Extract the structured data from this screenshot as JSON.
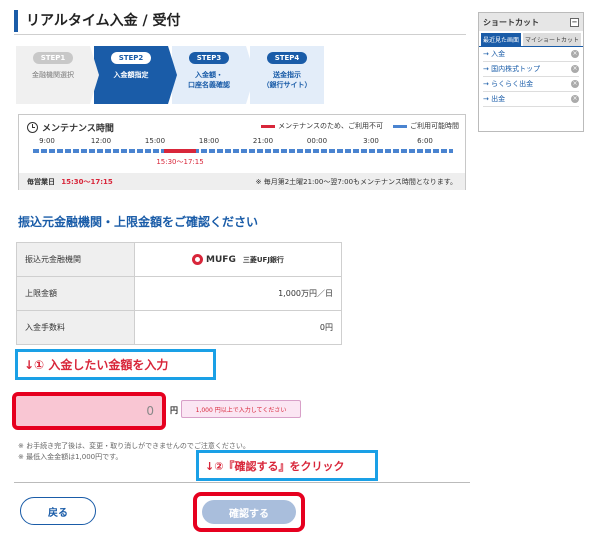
{
  "page": {
    "title": "リアルタイム入金 / 受付"
  },
  "steps": [
    {
      "badge": "STEP1",
      "label": "金融機関選択",
      "state": "done"
    },
    {
      "badge": "STEP2",
      "label": "入金額指定",
      "state": "current"
    },
    {
      "badge": "STEP3",
      "label": "入金額・\n口座名義確認",
      "state": "todo"
    },
    {
      "badge": "STEP4",
      "label": "送金指示\n（銀行サイト）",
      "state": "todo"
    }
  ],
  "maintenance": {
    "title": "メンテナンス時間",
    "legend": {
      "unavailable": "メンテナンスのため、ご利用不可",
      "available": "ご利用可能時間"
    },
    "colors": {
      "unavailable": "#d8263a",
      "available": "#4a84d0"
    },
    "times": [
      "9:00",
      "12:00",
      "15:00",
      "18:00",
      "21:00",
      "00:00",
      "3:00",
      "6:00"
    ],
    "red_range_label": "15:30〜17:15",
    "daily_label": "毎営業日",
    "daily_value": "15:30〜17:15",
    "note": "※ 毎月第2土曜21:00〜翌7:00もメンテナンス時間となります。"
  },
  "shortcut": {
    "title": "ショートカット",
    "min_icon": "−",
    "tabs": [
      "最近見た画面",
      "マイショートカット"
    ],
    "items": [
      "入金",
      "国内株式トップ",
      "らくらく出金",
      "出金"
    ],
    "delete_icon": "×"
  },
  "section": {
    "title": "振込元金融機関・上限金額をご確認ください"
  },
  "table": {
    "rows": [
      {
        "label": "振込元金融機関",
        "value": ""
      },
      {
        "label": "上限金額",
        "value": "1,000万円／日"
      },
      {
        "label": "入金手数料",
        "value": "0円"
      }
    ],
    "bank": {
      "logo_text": "MUFG",
      "sub": "三菱UFJ銀行"
    }
  },
  "annotation1": "↓① 入金したい金額を入力",
  "amount": {
    "value": "0",
    "unit": "円",
    "hint": "1,000 円以上で入力してください"
  },
  "notes": [
    "※ お手続き完了後は、変更・取り消しができませんのでご注意ください。",
    "※ 最低入金金額は1,000円です。"
  ],
  "annotation2": "↓②『確認する』をクリック",
  "buttons": {
    "back": "戻る",
    "confirm": "確認する"
  }
}
